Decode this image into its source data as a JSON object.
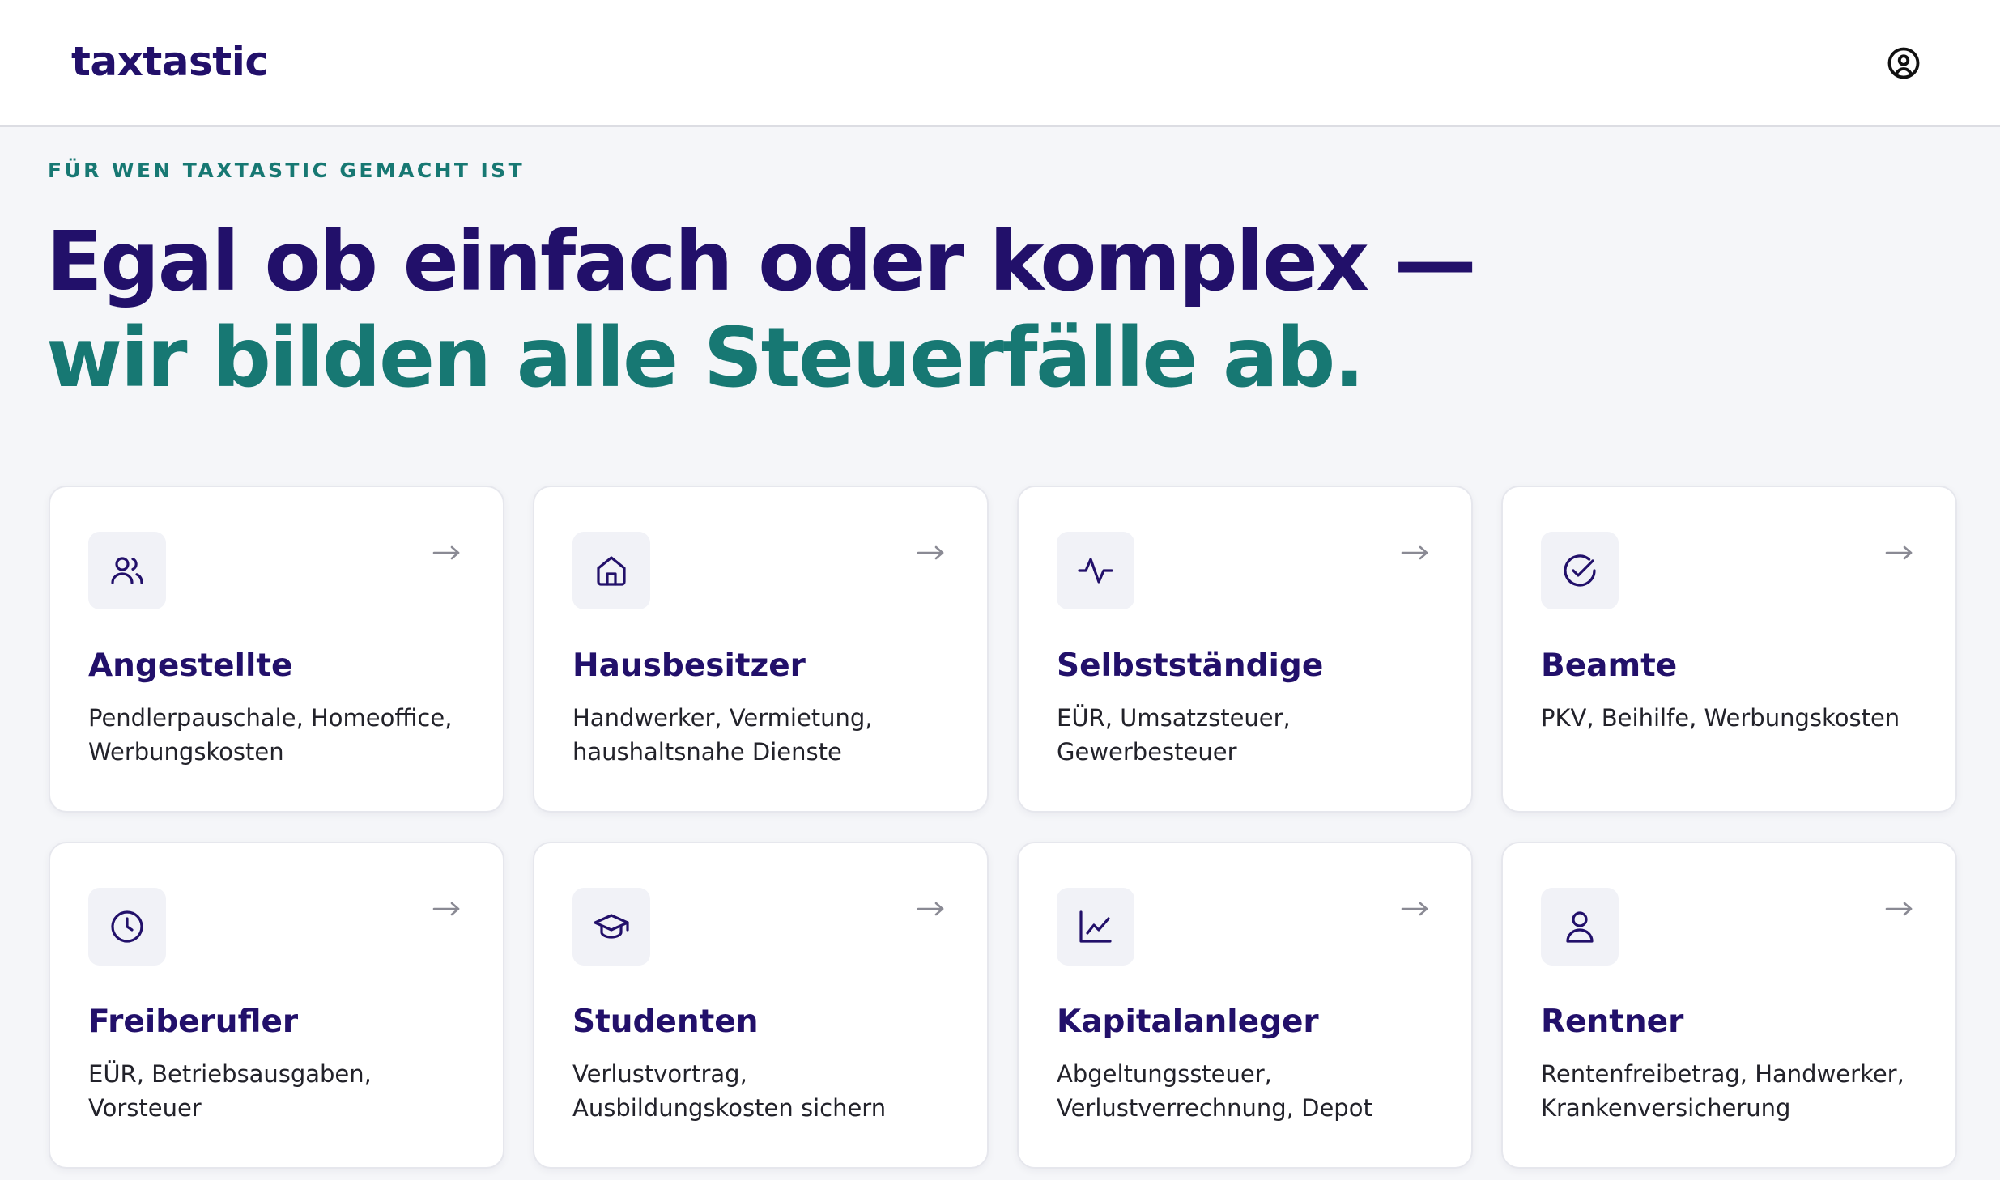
{
  "header": {
    "logo": "taxtastic",
    "account_icon": "user-circle-icon"
  },
  "hero": {
    "eyebrow": "FÜR WEN TAXTASTIC GEMACHT IST",
    "headline_part1": "Egal ob einfach oder komplex — ",
    "headline_part2": "wir bilden alle Steuerfälle ab."
  },
  "colors": {
    "brand_dark": "#22106a",
    "brand_teal": "#177873",
    "page_bg": "#f5f6f9"
  },
  "cards": [
    {
      "title": "Angestellte",
      "description": "Pendlerpauschale, Homeoffice, Werbungskosten",
      "icon": "users-icon"
    },
    {
      "title": "Hausbesitzer",
      "description": "Handwerker, Vermietung, haushaltsnahe Dienste",
      "icon": "home-icon"
    },
    {
      "title": "Selbstständige",
      "description": "EÜR, Umsatzsteuer, Gewerbesteuer",
      "icon": "activity-icon"
    },
    {
      "title": "Beamte",
      "description": "PKV, Beihilfe, Werbungskosten",
      "icon": "check-circle-icon"
    },
    {
      "title": "Freiberufler",
      "description": "EÜR, Betriebsausgaben, Vorsteuer",
      "icon": "clock-icon"
    },
    {
      "title": "Studenten",
      "description": "Verlustvortrag, Ausbildungskosten sichern",
      "icon": "graduation-cap-icon"
    },
    {
      "title": "Kapitalanleger",
      "description": "Abgeltungssteuer, Verlustverrechnung, Depot",
      "icon": "line-chart-icon"
    },
    {
      "title": "Rentner",
      "description": "Rentenfreibetrag, Handwerker, Krankenversicherung",
      "icon": "user-icon"
    }
  ]
}
